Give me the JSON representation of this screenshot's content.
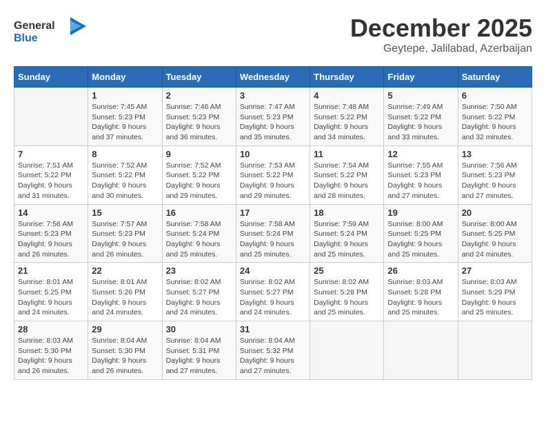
{
  "header": {
    "logo_general": "General",
    "logo_blue": "Blue",
    "month_title": "December 2025",
    "location": "Geytepe, Jalilabad, Azerbaijan"
  },
  "weekdays": [
    "Sunday",
    "Monday",
    "Tuesday",
    "Wednesday",
    "Thursday",
    "Friday",
    "Saturday"
  ],
  "weeks": [
    [
      {
        "day": "",
        "info": ""
      },
      {
        "day": "1",
        "info": "Sunrise: 7:45 AM\nSunset: 5:23 PM\nDaylight: 9 hours\nand 37 minutes."
      },
      {
        "day": "2",
        "info": "Sunrise: 7:46 AM\nSunset: 5:23 PM\nDaylight: 9 hours\nand 36 minutes."
      },
      {
        "day": "3",
        "info": "Sunrise: 7:47 AM\nSunset: 5:23 PM\nDaylight: 9 hours\nand 35 minutes."
      },
      {
        "day": "4",
        "info": "Sunrise: 7:48 AM\nSunset: 5:22 PM\nDaylight: 9 hours\nand 34 minutes."
      },
      {
        "day": "5",
        "info": "Sunrise: 7:49 AM\nSunset: 5:22 PM\nDaylight: 9 hours\nand 33 minutes."
      },
      {
        "day": "6",
        "info": "Sunrise: 7:50 AM\nSunset: 5:22 PM\nDaylight: 9 hours\nand 32 minutes."
      }
    ],
    [
      {
        "day": "7",
        "info": "Sunrise: 7:51 AM\nSunset: 5:22 PM\nDaylight: 9 hours\nand 31 minutes."
      },
      {
        "day": "8",
        "info": "Sunrise: 7:52 AM\nSunset: 5:22 PM\nDaylight: 9 hours\nand 30 minutes."
      },
      {
        "day": "9",
        "info": "Sunrise: 7:52 AM\nSunset: 5:22 PM\nDaylight: 9 hours\nand 29 minutes."
      },
      {
        "day": "10",
        "info": "Sunrise: 7:53 AM\nSunset: 5:22 PM\nDaylight: 9 hours\nand 29 minutes."
      },
      {
        "day": "11",
        "info": "Sunrise: 7:54 AM\nSunset: 5:22 PM\nDaylight: 9 hours\nand 28 minutes."
      },
      {
        "day": "12",
        "info": "Sunrise: 7:55 AM\nSunset: 5:23 PM\nDaylight: 9 hours\nand 27 minutes."
      },
      {
        "day": "13",
        "info": "Sunrise: 7:56 AM\nSunset: 5:23 PM\nDaylight: 9 hours\nand 27 minutes."
      }
    ],
    [
      {
        "day": "14",
        "info": "Sunrise: 7:56 AM\nSunset: 5:23 PM\nDaylight: 9 hours\nand 26 minutes."
      },
      {
        "day": "15",
        "info": "Sunrise: 7:57 AM\nSunset: 5:23 PM\nDaylight: 9 hours\nand 26 minutes."
      },
      {
        "day": "16",
        "info": "Sunrise: 7:58 AM\nSunset: 5:24 PM\nDaylight: 9 hours\nand 25 minutes."
      },
      {
        "day": "17",
        "info": "Sunrise: 7:58 AM\nSunset: 5:24 PM\nDaylight: 9 hours\nand 25 minutes."
      },
      {
        "day": "18",
        "info": "Sunrise: 7:59 AM\nSunset: 5:24 PM\nDaylight: 9 hours\nand 25 minutes."
      },
      {
        "day": "19",
        "info": "Sunrise: 8:00 AM\nSunset: 5:25 PM\nDaylight: 9 hours\nand 25 minutes."
      },
      {
        "day": "20",
        "info": "Sunrise: 8:00 AM\nSunset: 5:25 PM\nDaylight: 9 hours\nand 24 minutes."
      }
    ],
    [
      {
        "day": "21",
        "info": "Sunrise: 8:01 AM\nSunset: 5:25 PM\nDaylight: 9 hours\nand 24 minutes."
      },
      {
        "day": "22",
        "info": "Sunrise: 8:01 AM\nSunset: 5:26 PM\nDaylight: 9 hours\nand 24 minutes."
      },
      {
        "day": "23",
        "info": "Sunrise: 8:02 AM\nSunset: 5:27 PM\nDaylight: 9 hours\nand 24 minutes."
      },
      {
        "day": "24",
        "info": "Sunrise: 8:02 AM\nSunset: 5:27 PM\nDaylight: 9 hours\nand 24 minutes."
      },
      {
        "day": "25",
        "info": "Sunrise: 8:02 AM\nSunset: 5:28 PM\nDaylight: 9 hours\nand 25 minutes."
      },
      {
        "day": "26",
        "info": "Sunrise: 8:03 AM\nSunset: 5:28 PM\nDaylight: 9 hours\nand 25 minutes."
      },
      {
        "day": "27",
        "info": "Sunrise: 8:03 AM\nSunset: 5:29 PM\nDaylight: 9 hours\nand 25 minutes."
      }
    ],
    [
      {
        "day": "28",
        "info": "Sunrise: 8:03 AM\nSunset: 5:30 PM\nDaylight: 9 hours\nand 26 minutes."
      },
      {
        "day": "29",
        "info": "Sunrise: 8:04 AM\nSunset: 5:30 PM\nDaylight: 9 hours\nand 26 minutes."
      },
      {
        "day": "30",
        "info": "Sunrise: 8:04 AM\nSunset: 5:31 PM\nDaylight: 9 hours\nand 27 minutes."
      },
      {
        "day": "31",
        "info": "Sunrise: 8:04 AM\nSunset: 5:32 PM\nDaylight: 9 hours\nand 27 minutes."
      },
      {
        "day": "",
        "info": ""
      },
      {
        "day": "",
        "info": ""
      },
      {
        "day": "",
        "info": ""
      }
    ]
  ]
}
